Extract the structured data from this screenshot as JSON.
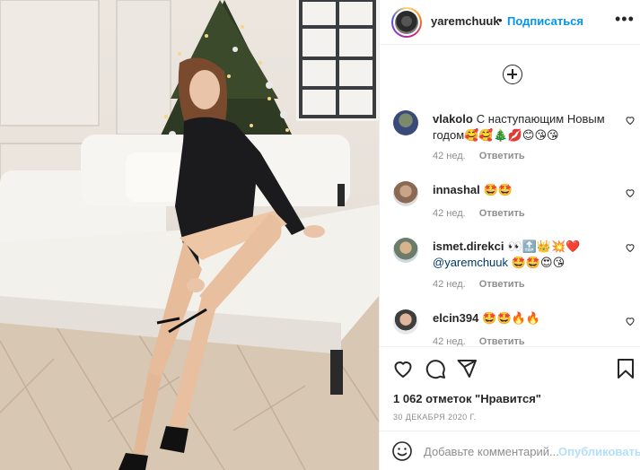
{
  "post": {
    "image_alt": "woman in black bodysuit sitting on white sofa near christmas tree"
  },
  "header": {
    "username": "yaremchuuk",
    "separator": "•",
    "follow_label": "Подписаться",
    "more_label": "•••"
  },
  "comments": [
    {
      "user": "vlakolo",
      "text": "С наступающим Новым годом🥰🥰🎄💋😊😘😘",
      "age": "42 нед.",
      "reply": "Ответить"
    },
    {
      "user": "innashal",
      "text": "🤩🤩",
      "age": "42 нед.",
      "reply": "Ответить"
    },
    {
      "user": "ismet.direkci",
      "text": "👀🔝👑💥❤️",
      "mention": "@yaremchuuk",
      "text2": "🤩🤩😍😘",
      "age": "42 нед.",
      "reply": "Ответить"
    },
    {
      "user": "elcin394",
      "text": "🤩🤩🔥🔥",
      "age": "42 нед.",
      "reply": "Ответить"
    }
  ],
  "actions": {
    "likes": "1 062 отметок \"Нравится\"",
    "date": "30 ДЕКАБРЯ 2020 Г."
  },
  "add_comment": {
    "placeholder": "Добавьте комментарий...",
    "publish_label": "Опубликовать"
  },
  "colors": {
    "accent": "#0095f6",
    "publish_disabled": "#b2dffc",
    "meta": "#8e8e8e",
    "text": "#262626"
  },
  "icons": [
    "plus-circle-icon",
    "heart-icon",
    "comment-icon",
    "share-icon",
    "bookmark-icon",
    "smile-icon",
    "more-icon"
  ]
}
